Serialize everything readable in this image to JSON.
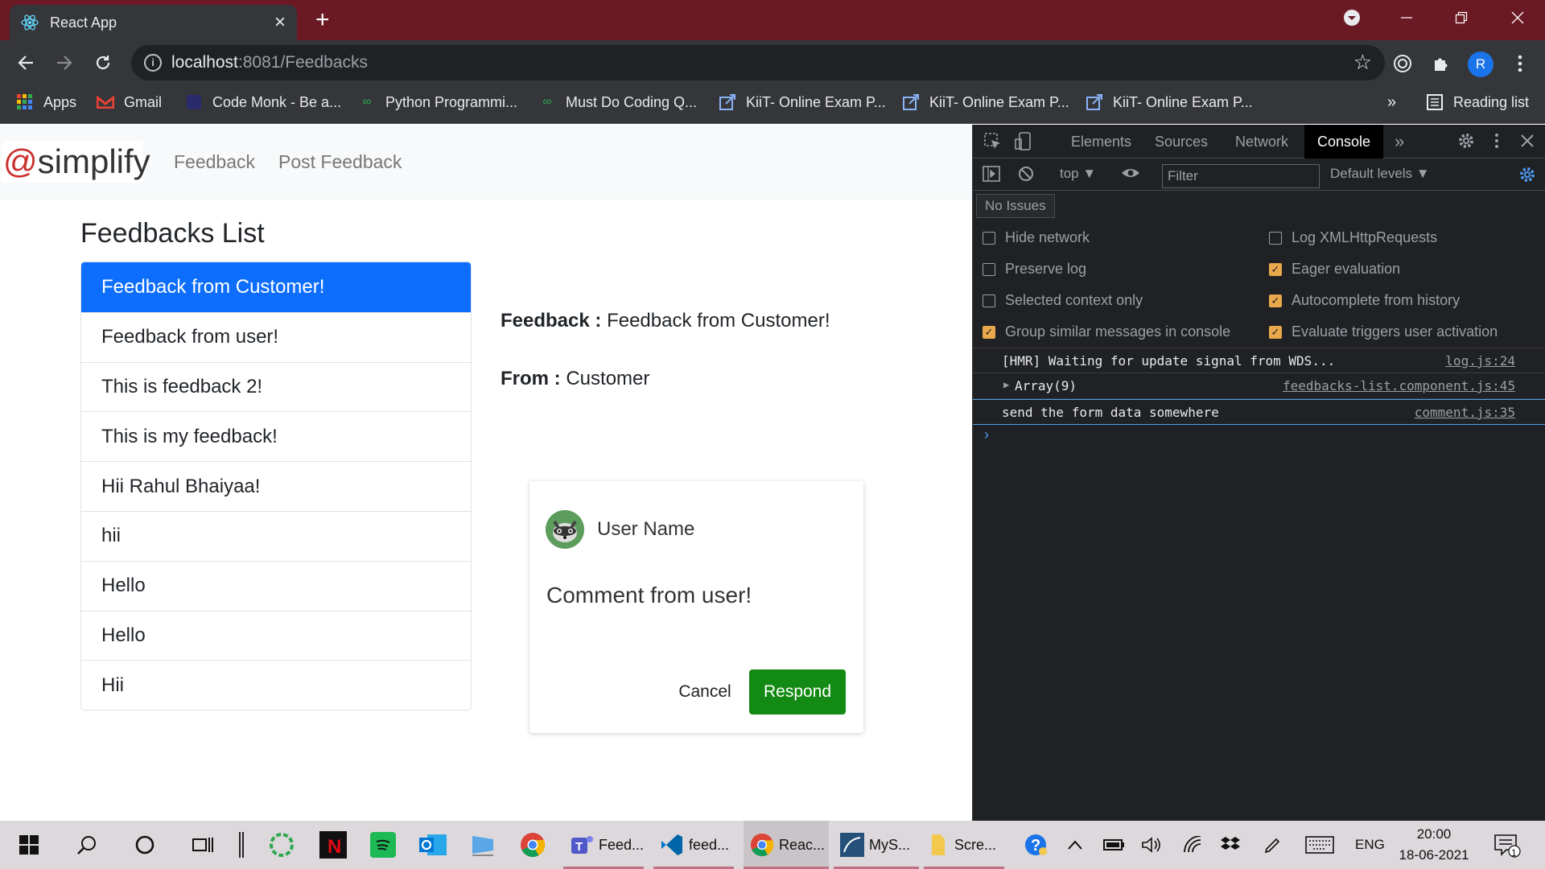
{
  "browser": {
    "tab_title": "React App",
    "tab_close": "×",
    "new_tab": "+",
    "url_host": "localhost",
    "url_rest": ":8081/Feedbacks",
    "profile_initial": "R"
  },
  "bookmarks": {
    "items": [
      "Apps",
      "Gmail",
      "Code Monk - Be a...",
      "Python Programmi...",
      "Must Do Coding Q...",
      "KiiT- Online Exam P...",
      "KiiT- Online Exam P...",
      "KiiT- Online Exam P..."
    ],
    "more": "»",
    "reading_list": "Reading list"
  },
  "app": {
    "brand_at": "@",
    "brand_name": "simplify",
    "nav": [
      "Feedback",
      "Post Feedback"
    ],
    "list_title": "Feedbacks List",
    "feedbacks": [
      "Feedback from Customer!",
      "Feedback from user!",
      "This is feedback 2!",
      "This is my feedback!",
      "Hii Rahul Bhaiyaa!",
      "hii",
      "Hello",
      "Hello",
      "Hii"
    ],
    "detail": {
      "feedback_label": "Feedback :",
      "feedback_value": "Feedback from Customer!",
      "from_label": "From :",
      "from_value": "Customer"
    },
    "comment_card": {
      "user_name": "User Name",
      "comment": "Comment from user!",
      "cancel": "Cancel",
      "respond": "Respond"
    }
  },
  "devtools": {
    "tabs": [
      "Elements",
      "Sources",
      "Network",
      "Console"
    ],
    "active_tab": "Console",
    "more_tabs": "»",
    "context": "top ▼",
    "filter_placeholder": "Filter",
    "levels": "Default levels ▼",
    "no_issues": "No Issues",
    "options_left": [
      {
        "label": "Hide network",
        "checked": false
      },
      {
        "label": "Preserve log",
        "checked": false
      },
      {
        "label": "Selected context only",
        "checked": false
      },
      {
        "label": "Group similar messages in console",
        "checked": true
      }
    ],
    "options_right": [
      {
        "label": "Log XMLHttpRequests",
        "checked": false
      },
      {
        "label": "Eager evaluation",
        "checked": true
      },
      {
        "label": "Autocomplete from history",
        "checked": true
      },
      {
        "label": "Evaluate triggers user activation",
        "checked": true
      }
    ],
    "logs": [
      {
        "msg": "[HMR] Waiting for update signal from WDS...",
        "src": "log.js:24"
      },
      {
        "msg": "Array(9)",
        "src": "feedbacks-list.component.js:45"
      },
      {
        "msg": "send the form data somewhere",
        "src": "comment.js:35"
      }
    ],
    "prompt": "›"
  },
  "taskbar": {
    "apps": [
      "Feed...",
      "feed...",
      "Reac...",
      "MyS...",
      "Scre..."
    ],
    "lang": "ENG",
    "time": "20:00",
    "date": "18-06-2021",
    "notification_count": "1"
  },
  "colors": {
    "titlebar": "#6b1a24",
    "active_item": "#0d6efd",
    "respond": "#138a13"
  }
}
